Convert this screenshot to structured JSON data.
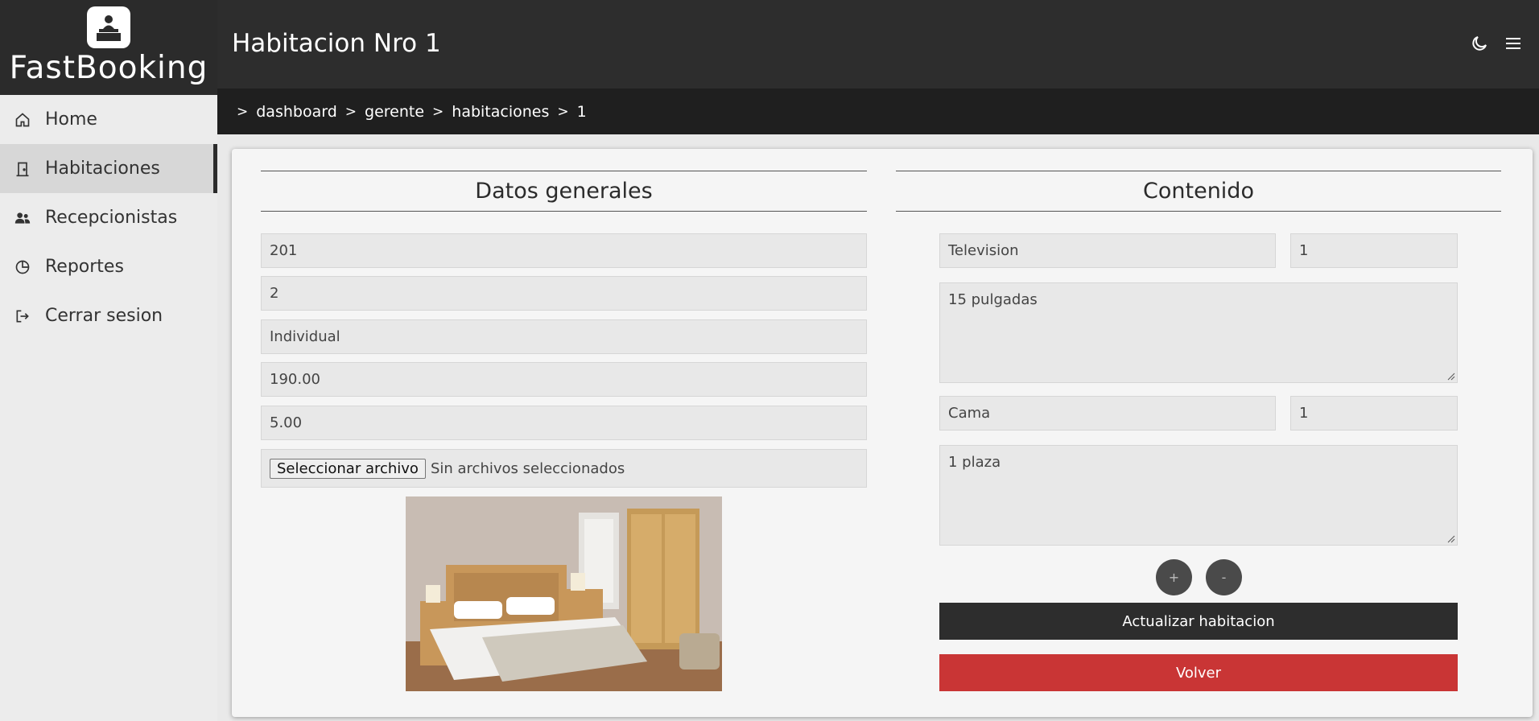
{
  "brand": {
    "name": "FastBooking",
    "logo_icon": "hotel-reception-icon"
  },
  "sidebar": {
    "items": [
      {
        "label": "Home",
        "icon": "home-icon"
      },
      {
        "label": "Habitaciones",
        "icon": "door-icon",
        "active": true
      },
      {
        "label": "Recepcionistas",
        "icon": "users-icon"
      },
      {
        "label": "Reportes",
        "icon": "pie-chart-icon"
      },
      {
        "label": "Cerrar sesion",
        "icon": "logout-icon"
      }
    ]
  },
  "header": {
    "title": "Habitacion Nro 1",
    "icons": [
      "moon-icon",
      "menu-icon"
    ]
  },
  "breadcrumb": [
    "dashboard",
    "gerente",
    "habitaciones",
    "1"
  ],
  "general": {
    "title": "Datos generales",
    "fields": [
      "201",
      "2",
      "Individual",
      "190.00",
      "5.00"
    ],
    "file_button": "Seleccionar archivo",
    "file_status": "Sin archivos seleccionados"
  },
  "content": {
    "title": "Contenido",
    "items": [
      {
        "name": "Television",
        "qty": "1",
        "description": "15 pulgadas"
      },
      {
        "name": "Cama",
        "qty": "1",
        "description": "1 plaza"
      }
    ],
    "add_label": "+",
    "remove_label": "-",
    "update_button": "Actualizar habitacion",
    "back_button": "Volver"
  },
  "colors": {
    "dark": "#2d2d2d",
    "breadcrumb_bg": "#1f1f1f",
    "danger": "#c93535",
    "round_button": "#4a4a4a"
  }
}
